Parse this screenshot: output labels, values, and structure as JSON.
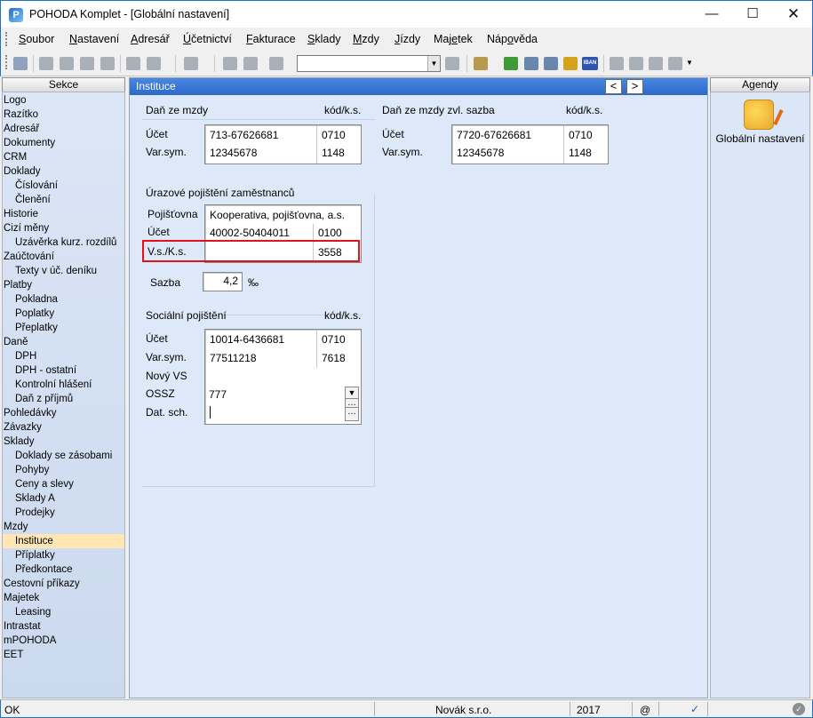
{
  "window": {
    "title": "POHODA Komplet - [Globální nastavení]",
    "app_icon": "P"
  },
  "menu": [
    {
      "label": "Soubor",
      "key": "S",
      "rest": "oubor"
    },
    {
      "label": "Nastavení",
      "key": "N",
      "rest": "astavení"
    },
    {
      "label": "Adresář",
      "key": "A",
      "rest": "dresář"
    },
    {
      "label": "Účetnictví",
      "key": "Ú",
      "rest": "četnictví"
    },
    {
      "label": "Fakturace",
      "key": "F",
      "rest": "akturace"
    },
    {
      "label": "Sklady",
      "key": "S",
      "rest": "klady"
    },
    {
      "label": "Mzdy",
      "key": "M",
      "rest": "zdy"
    },
    {
      "label": "Jízdy",
      "key": "J",
      "rest": "ízdy"
    },
    {
      "label": "Majetek",
      "pre": "Maj",
      "key": "e",
      "rest": "tek"
    },
    {
      "label": "Nápověda",
      "pre": "Náp",
      "key": "o",
      "rest": "věda"
    }
  ],
  "toolbar": {
    "combo_value": "",
    "iban_label": "IBAN"
  },
  "sidebar": {
    "header": "Sekce",
    "items": [
      {
        "label": "Logo",
        "level": 0
      },
      {
        "label": "Razítko",
        "level": 0
      },
      {
        "label": "Adresář",
        "level": 0
      },
      {
        "label": "Dokumenty",
        "level": 0
      },
      {
        "label": "CRM",
        "level": 0
      },
      {
        "label": "Doklady",
        "level": 0
      },
      {
        "label": "Číslování",
        "level": 1
      },
      {
        "label": "Členění",
        "level": 1
      },
      {
        "label": "Historie",
        "level": 0
      },
      {
        "label": "Cizí měny",
        "level": 0
      },
      {
        "label": "Uzávěrka kurz. rozdílů",
        "level": 1
      },
      {
        "label": "Zaúčtování",
        "level": 0
      },
      {
        "label": "Texty v úč. deníku",
        "level": 1
      },
      {
        "label": "Platby",
        "level": 0
      },
      {
        "label": "Pokladna",
        "level": 1
      },
      {
        "label": "Poplatky",
        "level": 1
      },
      {
        "label": "Přeplatky",
        "level": 1
      },
      {
        "label": "Daně",
        "level": 0
      },
      {
        "label": "DPH",
        "level": 1
      },
      {
        "label": "DPH - ostatní",
        "level": 1
      },
      {
        "label": "Kontrolní hlášení",
        "level": 1
      },
      {
        "label": "Daň z příjmů",
        "level": 1
      },
      {
        "label": "Pohledávky",
        "level": 0
      },
      {
        "label": "Závazky",
        "level": 0
      },
      {
        "label": "Sklady",
        "level": 0
      },
      {
        "label": "Doklady se zásobami",
        "level": 1
      },
      {
        "label": "Pohyby",
        "level": 1
      },
      {
        "label": "Ceny a slevy",
        "level": 1
      },
      {
        "label": "Sklady A",
        "level": 1
      },
      {
        "label": "Prodejky",
        "level": 1
      },
      {
        "label": "Mzdy",
        "level": 0
      },
      {
        "label": "Instituce",
        "level": 1,
        "selected": true
      },
      {
        "label": "Příplatky",
        "level": 1
      },
      {
        "label": "Předkontace",
        "level": 1
      },
      {
        "label": "Cestovní příkazy",
        "level": 0
      },
      {
        "label": "Majetek",
        "level": 0
      },
      {
        "label": "Leasing",
        "level": 1
      },
      {
        "label": "Intrastat",
        "level": 0
      },
      {
        "label": "mPOHODA",
        "level": 0
      },
      {
        "label": "EET",
        "level": 0
      }
    ]
  },
  "content": {
    "header": "Instituce",
    "nav_prev": "<",
    "nav_next": ">",
    "dan_ze_mzdy": {
      "title": "Daň ze mzdy",
      "code_header": "kód/k.s.",
      "ucet_label": "Účet",
      "ucet_value": "713-67626681",
      "ucet_code": "0710",
      "varsym_label": "Var.sym.",
      "varsym_value": "12345678",
      "varsym_code": "1148"
    },
    "dan_zvl": {
      "title": "Daň ze mzdy zvl. sazba",
      "code_header": "kód/k.s.",
      "ucet_label": "Účet",
      "ucet_value": "7720-67626681",
      "ucet_code": "0710",
      "varsym_label": "Var.sym.",
      "varsym_value": "12345678",
      "varsym_code": "1148"
    },
    "urazove": {
      "title": "Úrazové pojištění zaměstnanců",
      "pojistovna_label": "Pojišťovna",
      "pojistovna_value": "Kooperativa, pojišťovna, a.s.",
      "ucet_label": "Účet",
      "ucet_value": "40002-50404011",
      "ucet_code": "0100",
      "vsks_label": "V.s./K.s.",
      "vsks_value": "",
      "vsks_code": "3558",
      "sazba_label": "Sazba",
      "sazba_value": "4,2",
      "sazba_unit": "‰"
    },
    "socialni": {
      "title": "Sociální pojištění",
      "code_header": "kód/k.s.",
      "ucet_label": "Účet",
      "ucet_value": "10014-6436681",
      "ucet_code": "0710",
      "varsym_label": "Var.sym.",
      "varsym_value": "77511218",
      "varsym_code": "7618",
      "novyvs_label": "Nový VS",
      "ossz_label": "OSSZ",
      "ossz_value": "777",
      "datsch_label": "Dat. sch.",
      "datsch_value": ""
    }
  },
  "right_panel": {
    "header": "Agendy",
    "item_label": "Globální nastavení"
  },
  "status": {
    "left": "OK",
    "company": "Novák s.r.o.",
    "year": "2017",
    "at": "@"
  },
  "colors": {
    "accent": "#2c68c7",
    "selection": "#ffe6b2",
    "highlight": "#e3121a",
    "content_bg": "#dde9f8"
  }
}
